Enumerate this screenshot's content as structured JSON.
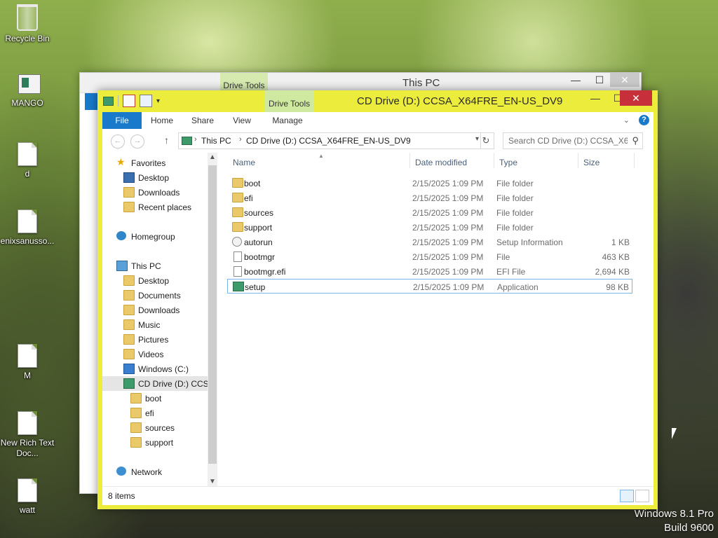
{
  "desktop": {
    "icons": [
      {
        "label": "Recycle Bin",
        "icon": "recycle-bin-icon"
      },
      {
        "label": "MANGO",
        "icon": "app-icon"
      },
      {
        "label": "d",
        "icon": "document-icon"
      },
      {
        "label": "enixsanusso...",
        "icon": "document-icon"
      },
      {
        "label": "M",
        "icon": "document-icon"
      },
      {
        "label": "New Rich Text Doc...",
        "icon": "rich-text-document-icon"
      },
      {
        "label": "watt",
        "icon": "document-icon"
      }
    ],
    "watermark": {
      "line1": "Windows 8.1 Pro",
      "line2": "Build 9600"
    }
  },
  "background_window": {
    "title": "This PC",
    "context_tab": "Drive Tools"
  },
  "window": {
    "title": "CD Drive (D:) CCSA_X64FRE_EN-US_DV9",
    "context_tab": "Drive Tools",
    "controls": {
      "minimize": "—",
      "maximize": "☐",
      "close": "✕"
    },
    "ribbon_tabs": [
      "File",
      "Home",
      "Share",
      "View",
      "Manage"
    ],
    "help": "?",
    "address": {
      "crumbs": [
        "This PC",
        "CD Drive (D:) CCSA_X64FRE_EN-US_DV9"
      ]
    },
    "search": {
      "placeholder": "Search CD Drive (D:) CCSA_X6..."
    },
    "nav": [
      {
        "label": "Favorites",
        "icon": "star"
      },
      {
        "label": "Desktop",
        "icon": "desk"
      },
      {
        "label": "Downloads",
        "icon": "folder"
      },
      {
        "label": "Recent places",
        "icon": "folder"
      },
      {
        "label": "Homegroup",
        "icon": "home"
      },
      {
        "label": "This PC",
        "icon": "pc"
      },
      {
        "label": "Desktop",
        "icon": "folder"
      },
      {
        "label": "Documents",
        "icon": "folder"
      },
      {
        "label": "Downloads",
        "icon": "folder"
      },
      {
        "label": "Music",
        "icon": "folder"
      },
      {
        "label": "Pictures",
        "icon": "folder"
      },
      {
        "label": "Videos",
        "icon": "folder"
      },
      {
        "label": "Windows (C:)",
        "icon": "win"
      },
      {
        "label": "CD Drive (D:) CCS",
        "icon": "cd"
      },
      {
        "label": "boot",
        "icon": "folder"
      },
      {
        "label": "efi",
        "icon": "folder"
      },
      {
        "label": "sources",
        "icon": "folder"
      },
      {
        "label": "support",
        "icon": "folder"
      },
      {
        "label": "Network",
        "icon": "net"
      }
    ],
    "columns": {
      "name": "Name",
      "date": "Date modified",
      "type": "Type",
      "size": "Size"
    },
    "files": [
      {
        "name": "boot",
        "date": "2/15/2025 1:09 PM",
        "type": "File folder",
        "size": "",
        "kind": "folder"
      },
      {
        "name": "efi",
        "date": "2/15/2025 1:09 PM",
        "type": "File folder",
        "size": "",
        "kind": "folder"
      },
      {
        "name": "sources",
        "date": "2/15/2025 1:09 PM",
        "type": "File folder",
        "size": "",
        "kind": "folder"
      },
      {
        "name": "support",
        "date": "2/15/2025 1:09 PM",
        "type": "File folder",
        "size": "",
        "kind": "folder"
      },
      {
        "name": "autorun",
        "date": "2/15/2025 1:09 PM",
        "type": "Setup Information",
        "size": "1 KB",
        "kind": "inf"
      },
      {
        "name": "bootmgr",
        "date": "2/15/2025 1:09 PM",
        "type": "File",
        "size": "463 KB",
        "kind": "file"
      },
      {
        "name": "bootmgr.efi",
        "date": "2/15/2025 1:09 PM",
        "type": "EFI File",
        "size": "2,694 KB",
        "kind": "file"
      },
      {
        "name": "setup",
        "date": "2/15/2025 1:09 PM",
        "type": "Application",
        "size": "98 KB",
        "kind": "app",
        "selected": true
      }
    ],
    "status": {
      "item_count": "8 items"
    },
    "colors": {
      "frame": "#ecec3c",
      "accent": "#1979ca",
      "selection_border": "#7bb4ea",
      "close": "#c7303a"
    }
  }
}
